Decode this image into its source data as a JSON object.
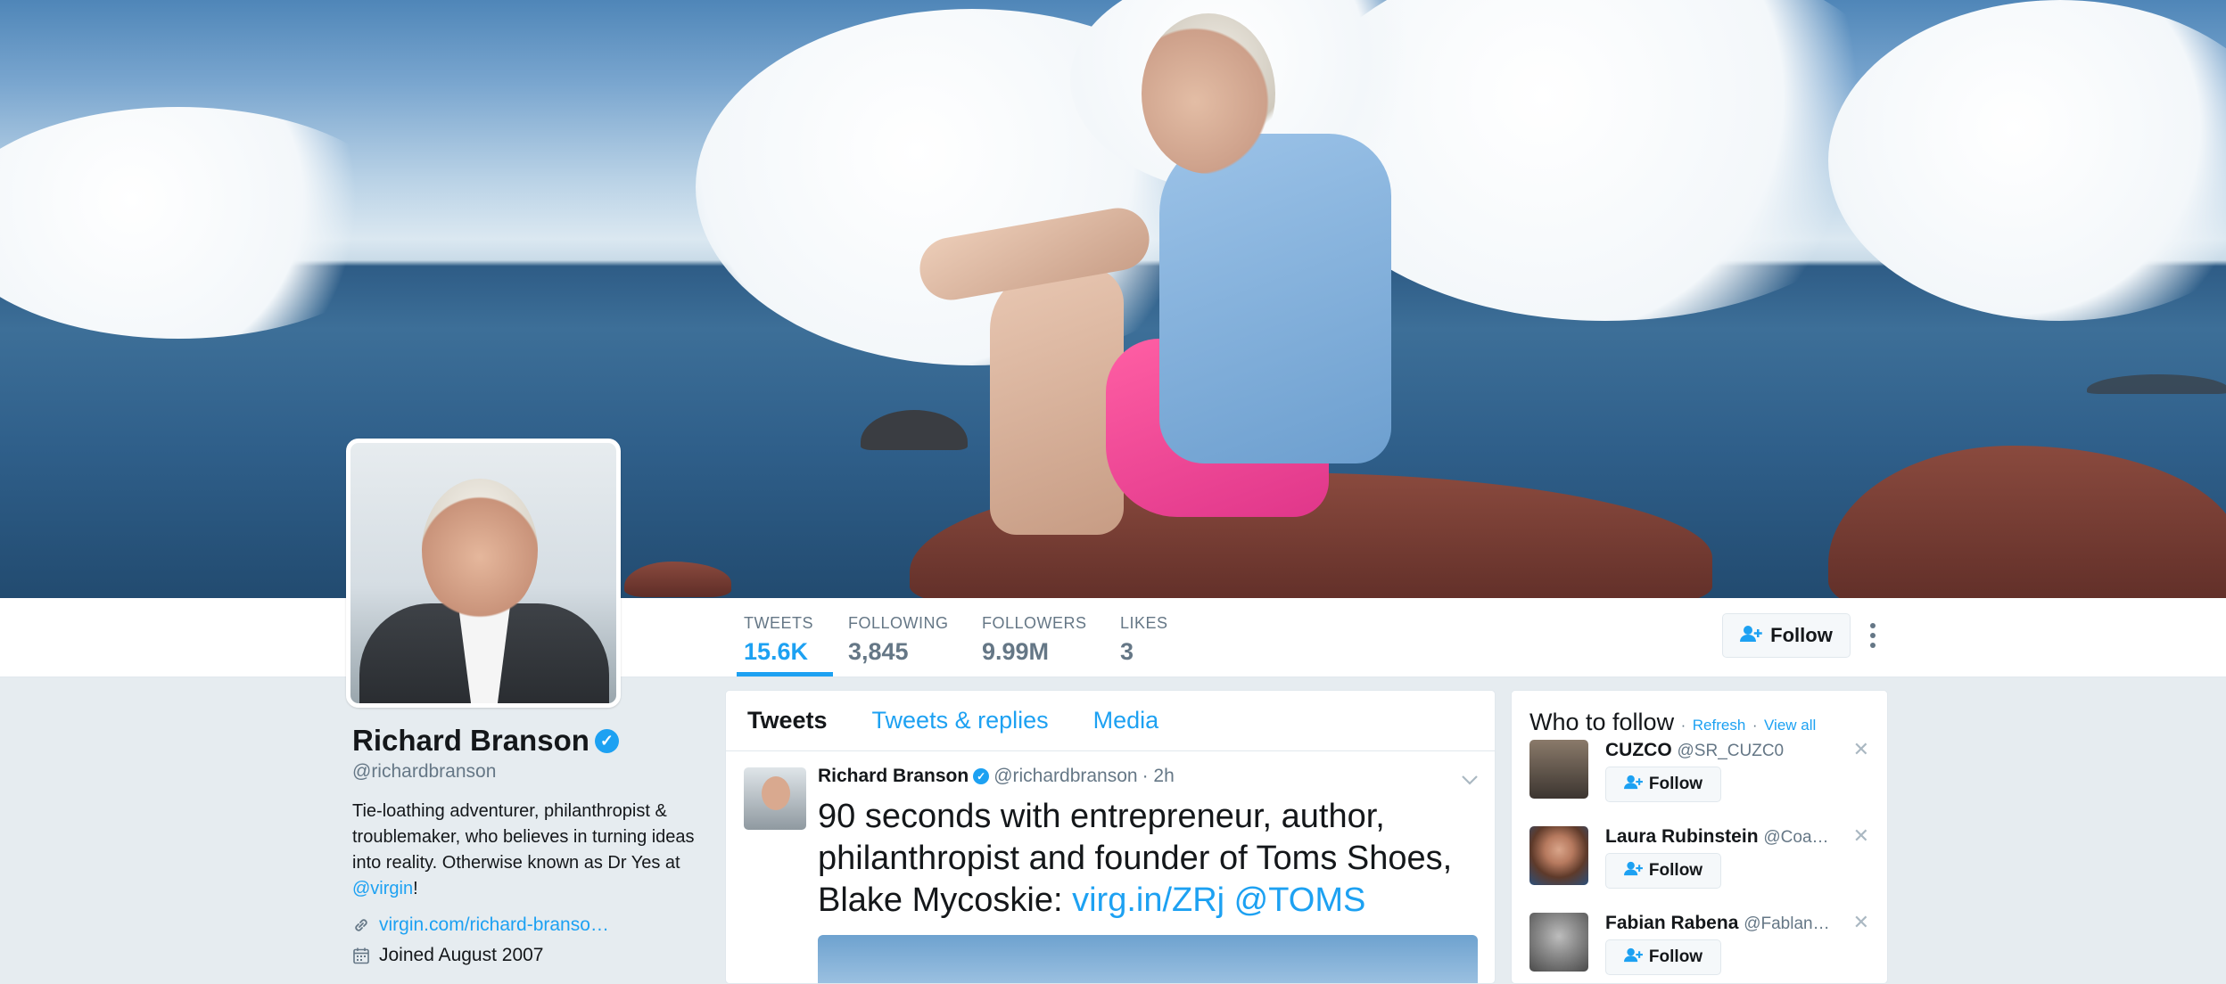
{
  "stats": [
    {
      "label": "Tweets",
      "value": "15.6K",
      "active": true
    },
    {
      "label": "Following",
      "value": "3,845"
    },
    {
      "label": "Followers",
      "value": "9.99M"
    },
    {
      "label": "Likes",
      "value": "3"
    }
  ],
  "header": {
    "follow_label": "Follow"
  },
  "profile": {
    "name": "Richard Branson",
    "handle": "@richardbranson",
    "bio_text": "Tie-loathing adventurer, philanthropist & troublemaker, who believes in turning ideas into reality. Otherwise known as Dr Yes at ",
    "bio_link": "@virgin",
    "bio_end": "!",
    "website": "virgin.com/richard-branso…",
    "joined": "Joined August 2007"
  },
  "timeline": {
    "tabs": [
      "Tweets",
      "Tweets & replies",
      "Media"
    ],
    "tweet": {
      "name": "Richard Branson",
      "handle": "@richardbranson",
      "time": "· 2h",
      "text": "90 seconds with entrepreneur, author, philanthropist and founder of Toms Shoes, Blake Mycoskie: ",
      "link": "virg.in/ZRj @TOMS"
    }
  },
  "who_to_follow": {
    "title": "Who to follow",
    "refresh": "Refresh",
    "view_all": "View all",
    "separator": "·",
    "follow_label": "Follow",
    "suggestions": [
      {
        "name": "CUZCO",
        "handle": "@SR_CUZC0"
      },
      {
        "name": "Laura Rubinstein",
        "handle": "@Coa…"
      },
      {
        "name": "Fabian Rabena",
        "handle": "@Fablan…"
      }
    ]
  },
  "icons": {
    "follow": "person-add-icon",
    "more": "vertical-dots-icon",
    "link": "link-icon",
    "calendar": "calendar-icon",
    "verified": "verified-badge-icon",
    "caret": "chevron-down-icon",
    "close": "close-icon"
  },
  "colors": {
    "accent": "#1da1f2",
    "muted": "#657786",
    "background": "#e6ecf0"
  }
}
